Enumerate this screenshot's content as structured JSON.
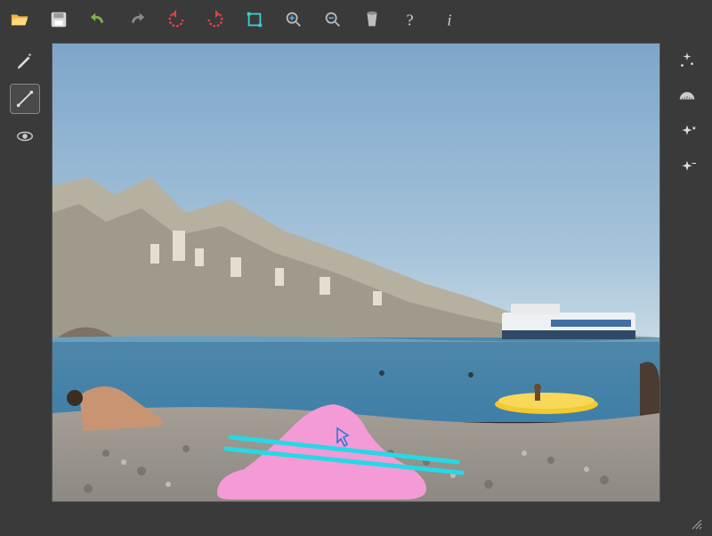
{
  "toolbar": {
    "open": {
      "name": "folder-open-icon",
      "tip": "Open"
    },
    "save": {
      "name": "save-icon",
      "tip": "Save"
    },
    "undo": {
      "name": "undo-icon",
      "tip": "Undo"
    },
    "redo": {
      "name": "redo-icon",
      "tip": "Redo"
    },
    "rotateL": {
      "name": "rotate-ccw-icon",
      "tip": "Rotate Left"
    },
    "rotateR": {
      "name": "rotate-cw-icon",
      "tip": "Rotate Right"
    },
    "crop": {
      "name": "crop-icon",
      "tip": "Crop"
    },
    "zoomIn": {
      "name": "zoom-in-icon",
      "tip": "Zoom In"
    },
    "zoomOut": {
      "name": "zoom-out-icon",
      "tip": "Zoom Out"
    },
    "fill": {
      "name": "bucket-icon",
      "tip": "Fill"
    },
    "help": {
      "name": "help-icon",
      "tip": "Help"
    },
    "info": {
      "name": "info-icon",
      "tip": "Info"
    }
  },
  "leftTools": {
    "pencil": {
      "name": "pencil-icon",
      "tip": "Brush",
      "selected": false
    },
    "line": {
      "name": "line-tool-icon",
      "tip": "Line",
      "selected": true
    },
    "eye": {
      "name": "redeye-icon",
      "tip": "Red-eye",
      "selected": false
    }
  },
  "rightTools": {
    "effects": {
      "name": "sparkle-icon",
      "tip": "Effects"
    },
    "protractor": {
      "name": "protractor-icon",
      "tip": "Straighten"
    },
    "contrast": {
      "name": "contrast-icon",
      "tip": "Contrast"
    },
    "brightness": {
      "name": "brightness-icon",
      "tip": "Brightness"
    }
  },
  "canvas": {
    "annotation": {
      "mask_color": "#f49ad6",
      "line_color": "#25d9e6",
      "cursor_color": "#2a7bd1"
    }
  }
}
